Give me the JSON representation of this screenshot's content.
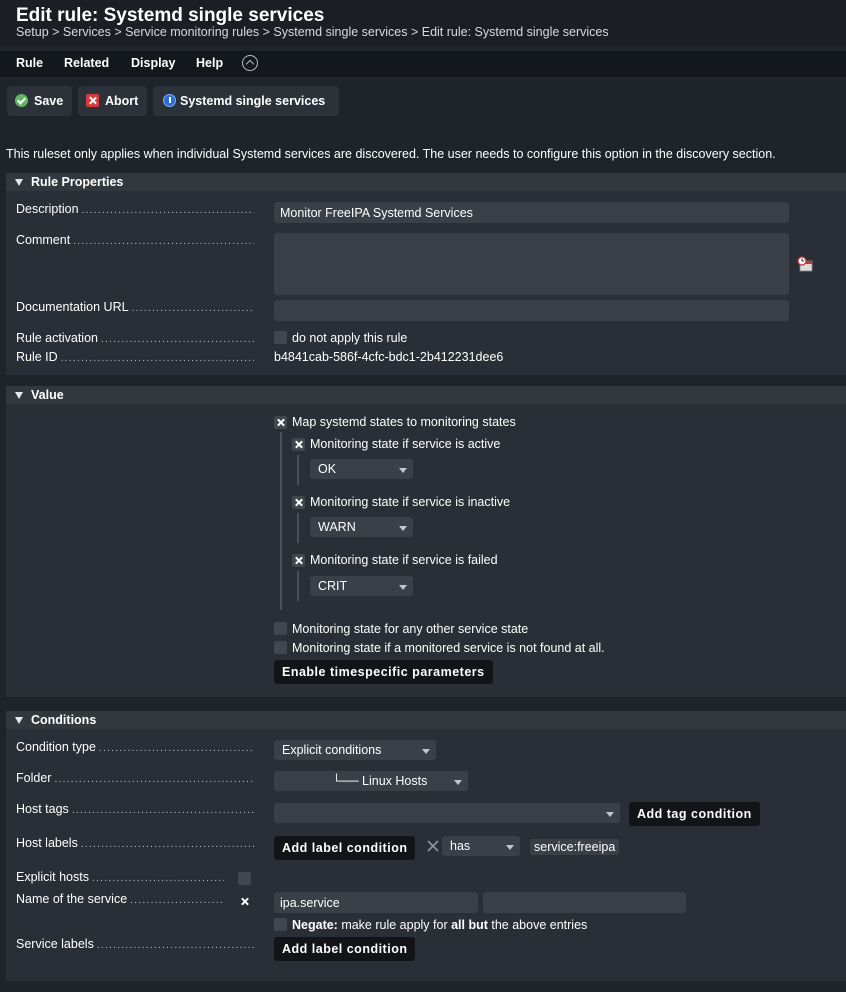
{
  "header": {
    "title": "Edit rule: Systemd single services",
    "breadcrumb": "Setup > Services > Service monitoring rules > Systemd single services > Edit rule: Systemd single services"
  },
  "menu": {
    "items": [
      "Rule",
      "Related",
      "Display",
      "Help"
    ]
  },
  "toolbar": {
    "save": "Save",
    "abort": "Abort",
    "ruleset": "Systemd single services"
  },
  "info": "This ruleset only applies when individual Systemd services are discovered. The user needs to configure this option in the discovery section.",
  "rule_properties": {
    "title": "Rule Properties",
    "description_label": "Description",
    "description_value": "Monitor FreeIPA Systemd Services",
    "comment_label": "Comment",
    "comment_value": "",
    "doc_url_label": "Documentation URL",
    "doc_url_value": "",
    "activation_label": "Rule activation",
    "activation_checkbox": "do not apply this rule",
    "rule_id_label": "Rule ID",
    "rule_id_value": "b4841cab-586f-4cfc-bdc1-2b412231dee6"
  },
  "value": {
    "title": "Value",
    "map_label": "Map systemd states to monitoring states",
    "active_label": "Monitoring state if service is active",
    "active_value": "OK",
    "inactive_label": "Monitoring state if service is inactive",
    "inactive_value": "WARN",
    "failed_label": "Monitoring state if service is failed",
    "failed_value": "CRIT",
    "other_label": "Monitoring state for any other service state",
    "notfound_label": "Monitoring state if a monitored service is not found at all.",
    "timespecific_button": "Enable timespecific parameters"
  },
  "conditions": {
    "title": "Conditions",
    "condition_type_label": "Condition type",
    "condition_type_value": "Explicit conditions",
    "folder_label": "Folder",
    "folder_value": "└── Linux Hosts",
    "host_tags_label": "Host tags",
    "add_tag_button": "Add tag condition",
    "host_labels_label": "Host labels",
    "add_label_button": "Add label condition",
    "label_operator": "has",
    "label_value": "service:freeipa",
    "explicit_hosts_label": "Explicit hosts",
    "service_name_label": "Name of the service",
    "service_name_value": "ipa.service",
    "service_name_extra": "",
    "negate_bold": "Negate:",
    "negate_text1": " make rule apply for ",
    "negate_bold2": "all but",
    "negate_text2": " the above entries",
    "service_labels_label": "Service labels",
    "add_service_label_button": "Add label condition"
  },
  "colors": {
    "background": "#1f232a",
    "panel": "#2a2e36",
    "ok_green": "#5fb75f",
    "abort_red": "#d83a3a",
    "info_blue": "#2b6fd1"
  }
}
